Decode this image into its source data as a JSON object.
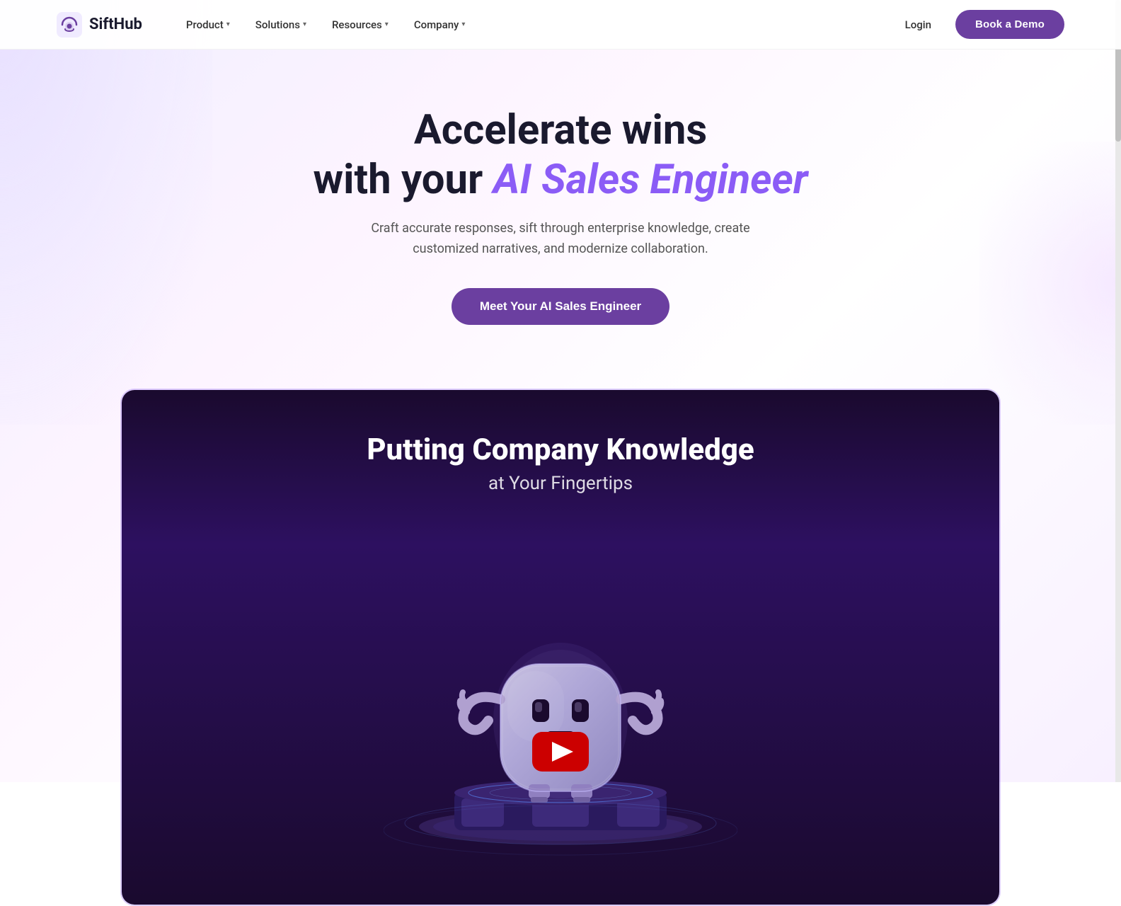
{
  "brand": {
    "name": "SiftHub",
    "logo_alt": "SiftHub logo"
  },
  "navbar": {
    "links": [
      {
        "label": "Product",
        "has_dropdown": true
      },
      {
        "label": "Solutions",
        "has_dropdown": true
      },
      {
        "label": "Resources",
        "has_dropdown": true
      },
      {
        "label": "Company",
        "has_dropdown": true
      }
    ],
    "login_label": "Login",
    "book_demo_label": "Book a Demo"
  },
  "hero": {
    "title_line1": "Accelerate wins",
    "title_line2_prefix": "with your ",
    "title_accent": "AI Sales Engineer",
    "subtitle": "Craft accurate responses, sift through enterprise knowledge, create customized narratives, and modernize collaboration.",
    "cta_label": "Meet Your AI Sales Engineer"
  },
  "video": {
    "title": "Putting Company Knowledge",
    "subtitle": "at Your Fingertips",
    "play_label": "Play video"
  },
  "colors": {
    "accent_purple": "#6b3fa0",
    "text_dark": "#1a1a2e",
    "text_accent": "#8b5cf6",
    "video_bg_top": "#1a0a2e",
    "video_bg_mid": "#2d1060",
    "play_red": "#ff0000"
  }
}
